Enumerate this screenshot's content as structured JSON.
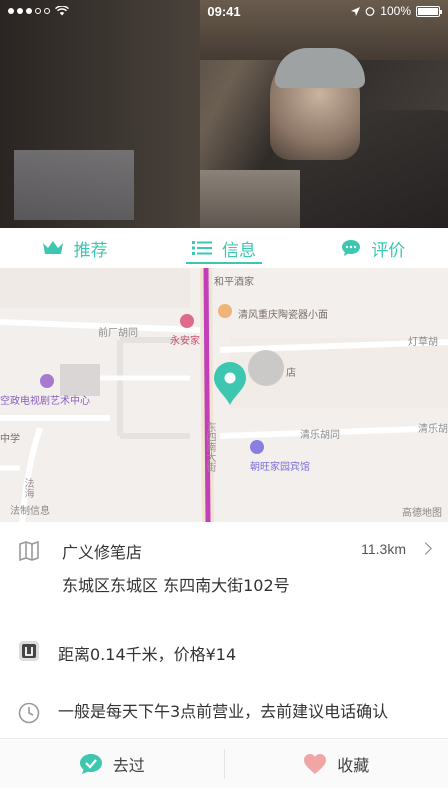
{
  "status_bar": {
    "time": "09:41",
    "battery": "100%"
  },
  "tabs": [
    {
      "label": "推荐",
      "icon": "crown-icon",
      "active": false
    },
    {
      "label": "信息",
      "icon": "list-icon",
      "active": true
    },
    {
      "label": "评价",
      "icon": "chat-bubble-icon",
      "active": false
    }
  ],
  "map": {
    "labels": {
      "hepingjiujia": "和平酒家",
      "qingfeng": "清风重庆陶瓷器小面",
      "qianchang": "前厂胡同",
      "yonganjia": "永安家",
      "dengshi": "灯草胡",
      "shop_partial": "店",
      "kongzheng": "空政电视剧艺术中心",
      "zhongxue": "中学",
      "qingle": "清乐胡同",
      "qingle_right": "清乐胡",
      "dongsi_south": "东四南大街",
      "chaowang": "朝旺家园宾馆",
      "fahai": "法海",
      "xinxi": "法制信息",
      "gaode": "高德地图"
    },
    "accent_color": "#3ec7b0",
    "road_color": "#c13fb8"
  },
  "shop": {
    "name": "广义修笔店",
    "distance": "11.3km",
    "address": "东城区东城区 东四南大街102号"
  },
  "price_line": "距离0.14千米，价格¥14",
  "hours_line": "一般是每天下午3点前营业，去前建议电话确认",
  "actions": {
    "visited": "去过",
    "favorite": "收藏"
  },
  "colors": {
    "accent": "#3ec7b0",
    "heart": "#f2a5a5"
  }
}
